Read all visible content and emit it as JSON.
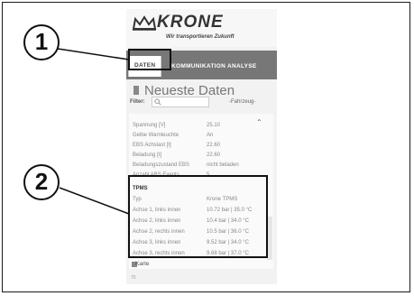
{
  "logo": {
    "brand": "KRONE",
    "tagline": "Wir transportieren Zukunft"
  },
  "nav": {
    "items": [
      "DATEN",
      "KOMMUNIKATION",
      "ANALYSE"
    ],
    "active_index": 0
  },
  "page": {
    "title": "Neueste Daten"
  },
  "filter": {
    "label": "Filter:",
    "placeholder": "",
    "select_value": "-Fahrzeug-"
  },
  "data_rows": [
    {
      "key": "Spannung [V]",
      "value": "25.10"
    },
    {
      "key": "Gelbe Warnleuchte",
      "value": "An"
    },
    {
      "key": "EBS Achslast [t]",
      "value": "22.60"
    },
    {
      "key": "Beladung [t]",
      "value": "22.60"
    },
    {
      "key": "Beladungszustand EBS",
      "value": "nicht beladen"
    },
    {
      "key": "Anzahl ABS Events",
      "value": "5"
    }
  ],
  "tpms": {
    "header": "TPMS",
    "rows": [
      {
        "key": "Typ",
        "value": "Krone TPMS"
      },
      {
        "key": "Achse 1, links innen",
        "value": "10.72 bar | 35.0 °C"
      },
      {
        "key": "Achse 2, links innen",
        "value": "10.4 bar | 34.0 °C"
      },
      {
        "key": "Achse 2, rechts innen",
        "value": "10.5 bar | 36.0 °C"
      },
      {
        "key": "Achse 3, links innen",
        "value": "9.52 bar | 34.0 °C"
      },
      {
        "key": "Achse 3, rechts innen",
        "value": "9.68 bar | 37.0 °C"
      }
    ]
  },
  "karte_label": "Karte",
  "footer_mark": "70",
  "callouts": [
    "1",
    "2"
  ]
}
